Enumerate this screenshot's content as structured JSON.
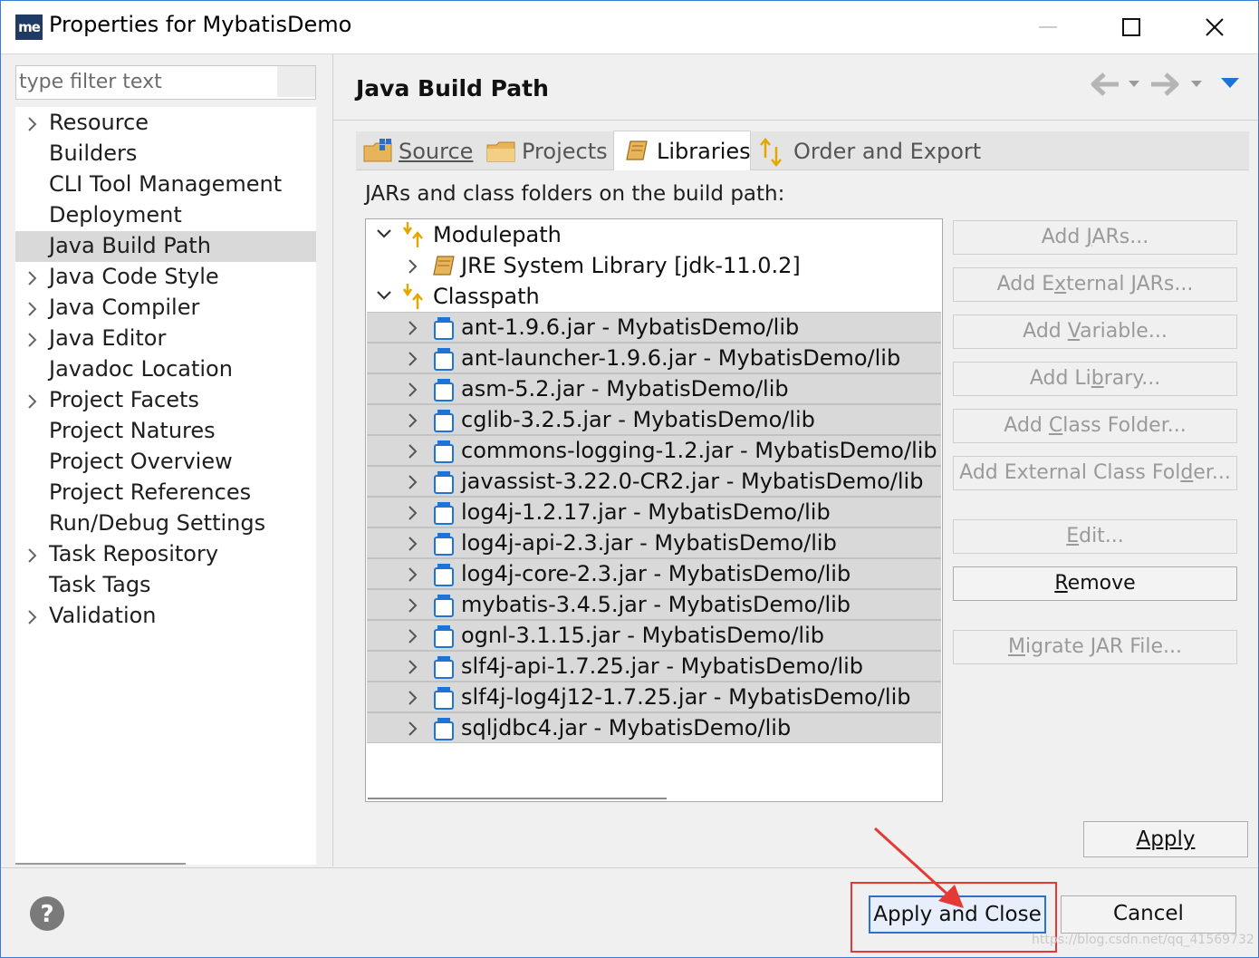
{
  "window": {
    "app_icon_text": "me",
    "title": "Properties for MybatisDemo"
  },
  "filter": {
    "placeholder": "type filter text"
  },
  "nav": {
    "items": [
      {
        "label": "Resource",
        "expandable": true
      },
      {
        "label": "Builders",
        "expandable": false
      },
      {
        "label": "CLI Tool Management",
        "expandable": false
      },
      {
        "label": "Deployment",
        "expandable": false
      },
      {
        "label": "Java Build Path",
        "expandable": false,
        "selected": true
      },
      {
        "label": "Java Code Style",
        "expandable": true
      },
      {
        "label": "Java Compiler",
        "expandable": true
      },
      {
        "label": "Java Editor",
        "expandable": true
      },
      {
        "label": "Javadoc Location",
        "expandable": false
      },
      {
        "label": "Project Facets",
        "expandable": true
      },
      {
        "label": "Project Natures",
        "expandable": false
      },
      {
        "label": "Project Overview",
        "expandable": false
      },
      {
        "label": "Project References",
        "expandable": false
      },
      {
        "label": "Run/Debug Settings",
        "expandable": false
      },
      {
        "label": "Task Repository",
        "expandable": true
      },
      {
        "label": "Task Tags",
        "expandable": false
      },
      {
        "label": "Validation",
        "expandable": true
      }
    ]
  },
  "page": {
    "title": "Java Build Path"
  },
  "tabs": [
    {
      "label": "Source",
      "icon": "source-folder-icon"
    },
    {
      "label": "Projects",
      "icon": "projects-folder-icon"
    },
    {
      "label": "Libraries",
      "icon": "libraries-icon",
      "active": true
    },
    {
      "label": "Order and Export",
      "icon": "order-export-icon"
    }
  ],
  "libraries": {
    "section_label": "JARs and class folders on the build path:",
    "modulepath_label": "Modulepath",
    "jre_label": "JRE System Library [jdk-11.0.2]",
    "classpath_label": "Classpath",
    "jars": [
      "ant-1.9.6.jar - MybatisDemo/lib",
      "ant-launcher-1.9.6.jar - MybatisDemo/lib",
      "asm-5.2.jar - MybatisDemo/lib",
      "cglib-3.2.5.jar - MybatisDemo/lib",
      "commons-logging-1.2.jar - MybatisDemo/lib",
      "javassist-3.22.0-CR2.jar - MybatisDemo/lib",
      "log4j-1.2.17.jar - MybatisDemo/lib",
      "log4j-api-2.3.jar - MybatisDemo/lib",
      "log4j-core-2.3.jar - MybatisDemo/lib",
      "mybatis-3.4.5.jar - MybatisDemo/lib",
      "ognl-3.1.15.jar - MybatisDemo/lib",
      "slf4j-api-1.7.25.jar - MybatisDemo/lib",
      "slf4j-log4j12-1.7.25.jar - MybatisDemo/lib",
      "sqljdbc4.jar - MybatisDemo/lib"
    ]
  },
  "buttons": {
    "add_jars": "Add JARs...",
    "add_external_jars": "Add External JARs...",
    "add_variable": "Add Variable...",
    "add_library": "Add Library...",
    "add_class_folder": "Add Class Folder...",
    "add_external_class_folder": "Add External Class Folder...",
    "edit": "Edit...",
    "remove": "Remove",
    "migrate_jar": "Migrate JAR File...",
    "apply": "Apply",
    "apply_and_close": "Apply and Close",
    "cancel": "Cancel"
  },
  "watermark": "https://blog.csdn.net/qq_41569732",
  "colors": {
    "accent": "#2f6fd0",
    "highlight": "#e53935",
    "selection": "#d9d9d9"
  }
}
